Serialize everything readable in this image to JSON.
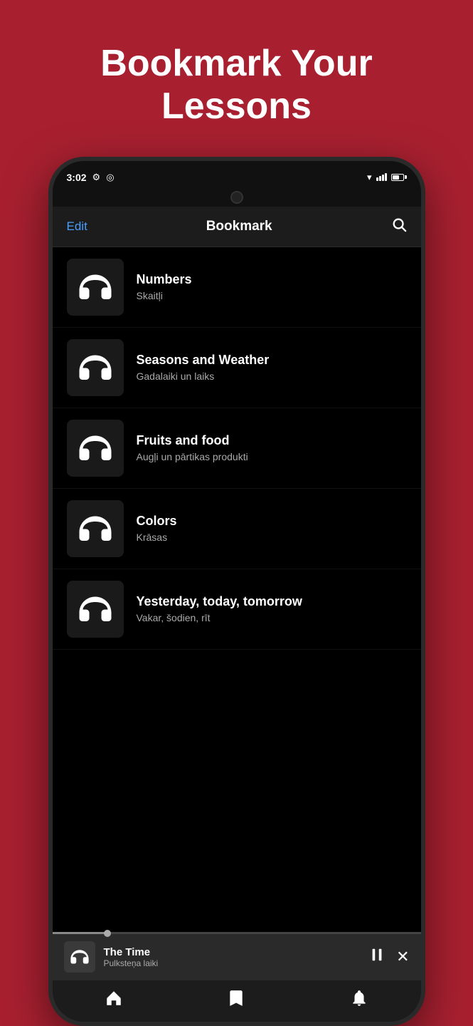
{
  "page": {
    "title_line1": "Bookmark Your",
    "title_line2": "Lessons"
  },
  "status_bar": {
    "time": "3:02",
    "icons": [
      "settings",
      "location",
      "wifi",
      "signal",
      "battery"
    ]
  },
  "app_bar": {
    "edit_label": "Edit",
    "title": "Bookmark",
    "search_label": "search"
  },
  "lessons": [
    {
      "title": "Numbers",
      "subtitle": "Skaitļi"
    },
    {
      "title": "Seasons and Weather",
      "subtitle": "Gadalaiki un laiks"
    },
    {
      "title": "Fruits and food",
      "subtitle": "Augļi un pārtikas produkti"
    },
    {
      "title": "Colors",
      "subtitle": "Krāsas"
    },
    {
      "title": "Yesterday, today, tomorrow",
      "subtitle": "Vakar, šodien, rīt"
    }
  ],
  "now_playing": {
    "title": "The Time",
    "subtitle": "Pulksteņa laiki",
    "pause_label": "pause",
    "close_label": "close"
  },
  "bottom_nav": {
    "items": [
      {
        "icon": "home",
        "label": "home"
      },
      {
        "icon": "bookmark",
        "label": "bookmark"
      },
      {
        "icon": "bell",
        "label": "notifications"
      }
    ]
  }
}
